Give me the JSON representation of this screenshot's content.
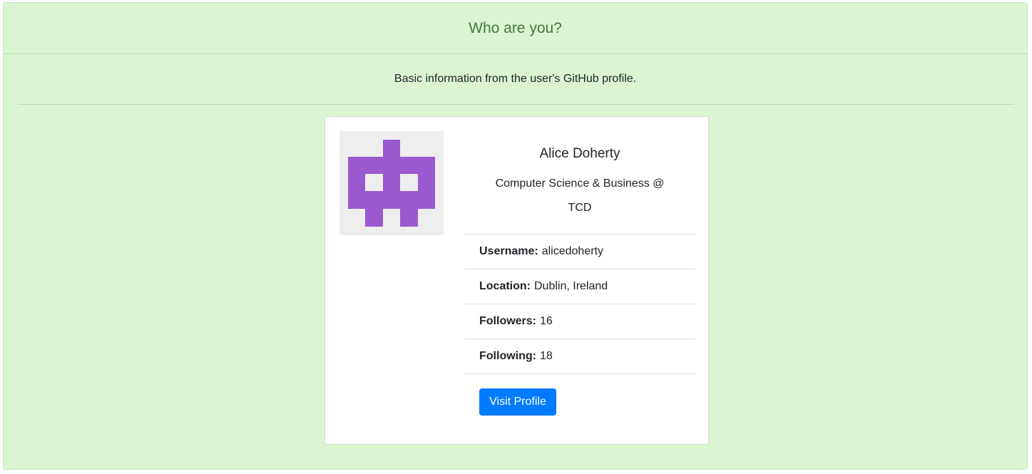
{
  "header": {
    "title": "Who are you?"
  },
  "subtitle": "Basic information from the user's GitHub profile.",
  "profile": {
    "name": "Alice Doherty",
    "bio": "Computer Science & Business @ TCD",
    "avatar_icon": "identicon-avatar",
    "avatar_color": "#9b59d0",
    "avatar_bg": "#eeeeee",
    "fields": [
      {
        "label": "Username:",
        "value": "alicedoherty"
      },
      {
        "label": "Location:",
        "value": "Dublin, Ireland"
      },
      {
        "label": "Followers:",
        "value": "16"
      },
      {
        "label": "Following:",
        "value": "18"
      }
    ],
    "button_label": "Visit Profile"
  },
  "colors": {
    "page_bg": "#dbf5d0",
    "header_text": "#3f7a3d",
    "button_bg": "#007bff"
  }
}
